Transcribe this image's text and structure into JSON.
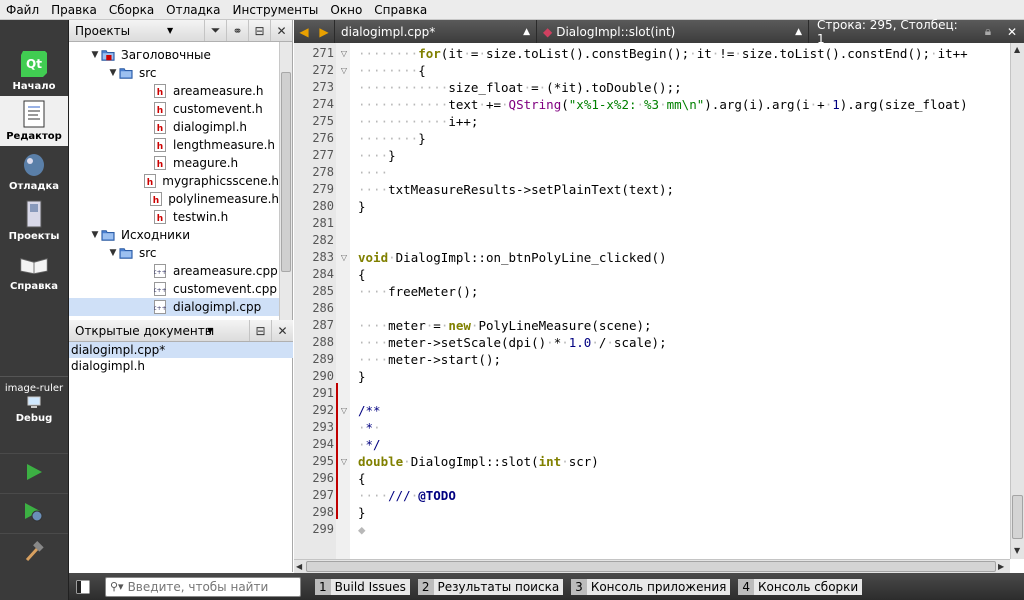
{
  "menu": [
    "Файл",
    "Правка",
    "Сборка",
    "Отладка",
    "Инструменты",
    "Окно",
    "Справка"
  ],
  "modes": [
    {
      "label": "Начало",
      "icon": "qt-logo-icon"
    },
    {
      "label": "Редактор",
      "icon": "editor-icon"
    },
    {
      "label": "Отладка",
      "icon": "debug-bug-icon"
    },
    {
      "label": "Проекты",
      "icon": "projects-icon"
    },
    {
      "label": "Справка",
      "icon": "help-book-icon"
    }
  ],
  "target": {
    "name": "image-ruler",
    "build": "Debug"
  },
  "projects_panel": {
    "title": "Проекты",
    "tree": [
      {
        "label": "Заголовочные",
        "level": 1,
        "kind": "folder-header"
      },
      {
        "label": "src",
        "level": 2,
        "kind": "folder"
      },
      {
        "label": "areameasure.h",
        "level": 3,
        "kind": "h"
      },
      {
        "label": "customevent.h",
        "level": 3,
        "kind": "h"
      },
      {
        "label": "dialogimpl.h",
        "level": 3,
        "kind": "h"
      },
      {
        "label": "lengthmeasure.h",
        "level": 3,
        "kind": "h"
      },
      {
        "label": "meagure.h",
        "level": 3,
        "kind": "h"
      },
      {
        "label": "mygraphicsscene.h",
        "level": 3,
        "kind": "h"
      },
      {
        "label": "polylinemeasure.h",
        "level": 3,
        "kind": "h"
      },
      {
        "label": "testwin.h",
        "level": 3,
        "kind": "h"
      },
      {
        "label": "Исходники",
        "level": 1,
        "kind": "folder-source"
      },
      {
        "label": "src",
        "level": 2,
        "kind": "folder"
      },
      {
        "label": "areameasure.cpp",
        "level": 3,
        "kind": "cpp"
      },
      {
        "label": "customevent.cpp",
        "level": 3,
        "kind": "cpp"
      },
      {
        "label": "dialogimpl.cpp",
        "level": 3,
        "kind": "cpp",
        "selected": true
      }
    ]
  },
  "open_documents": {
    "title": "Открытые документы",
    "items": [
      {
        "label": "dialogimpl.cpp*",
        "selected": true
      },
      {
        "label": "dialogimpl.h",
        "selected": false
      }
    ]
  },
  "editor_toolbar": {
    "file": "dialogimpl.cpp*",
    "symbol": "DialogImpl::slot(int)",
    "position": "Строка: 295, Столбец: 1"
  },
  "editor": {
    "lines": [
      {
        "n": "271",
        "fold": "▽",
        "text": "········for(it·=·size.toList().constBegin();·it·!=·size.toList().constEnd();·it++"
      },
      {
        "n": "272",
        "fold": "▽",
        "text": "········{"
      },
      {
        "n": "273",
        "fold": "",
        "text": "············size_float·=·(*it).toDouble();;"
      },
      {
        "n": "274",
        "fold": "",
        "text": "············text·+=·QString(\"x%1-x%2:·%3·mm\\n\").arg(i).arg(i·+·1).arg(size_float)"
      },
      {
        "n": "275",
        "fold": "",
        "text": "············i++;"
      },
      {
        "n": "276",
        "fold": "",
        "text": "········}"
      },
      {
        "n": "277",
        "fold": "",
        "text": "····}"
      },
      {
        "n": "278",
        "fold": "",
        "text": "····"
      },
      {
        "n": "279",
        "fold": "",
        "text": "····txtMeasureResults->setPlainText(text);"
      },
      {
        "n": "280",
        "fold": "",
        "text": "}"
      },
      {
        "n": "281",
        "fold": "",
        "text": ""
      },
      {
        "n": "282",
        "fold": "",
        "text": ""
      },
      {
        "n": "283",
        "fold": "▽",
        "text": "void·DialogImpl::on_btnPolyLine_clicked()"
      },
      {
        "n": "284",
        "fold": "",
        "text": "{"
      },
      {
        "n": "285",
        "fold": "",
        "text": "····freeMeter();"
      },
      {
        "n": "286",
        "fold": "",
        "text": ""
      },
      {
        "n": "287",
        "fold": "",
        "text": "····meter·=·new·PolyLineMeasure(scene);"
      },
      {
        "n": "288",
        "fold": "",
        "text": "····meter->setScale(dpi()·*·1.0·/·scale);"
      },
      {
        "n": "289",
        "fold": "",
        "text": "····meter->start();"
      },
      {
        "n": "290",
        "fold": "",
        "text": "}"
      },
      {
        "n": "291",
        "fold": "",
        "text": ""
      },
      {
        "n": "292",
        "fold": "▽",
        "text": "/**"
      },
      {
        "n": "293",
        "fold": "",
        "text": "·*·"
      },
      {
        "n": "294",
        "fold": "",
        "text": "·*/"
      },
      {
        "n": "295",
        "fold": "▽",
        "text": "double·DialogImpl::slot(int·scr)"
      },
      {
        "n": "296",
        "fold": "",
        "text": "{"
      },
      {
        "n": "297",
        "fold": "",
        "text": "····///·@TODO"
      },
      {
        "n": "298",
        "fold": "",
        "text": "}"
      },
      {
        "n": "299",
        "fold": "",
        "text": "◆"
      }
    ]
  },
  "locator": {
    "placeholder": "Введите, чтобы найти"
  },
  "output_tabs": [
    {
      "num": "1",
      "label": "Build Issues"
    },
    {
      "num": "2",
      "label": "Результаты поиска"
    },
    {
      "num": "3",
      "label": "Консоль приложения"
    },
    {
      "num": "4",
      "label": "Консоль сборки"
    }
  ]
}
